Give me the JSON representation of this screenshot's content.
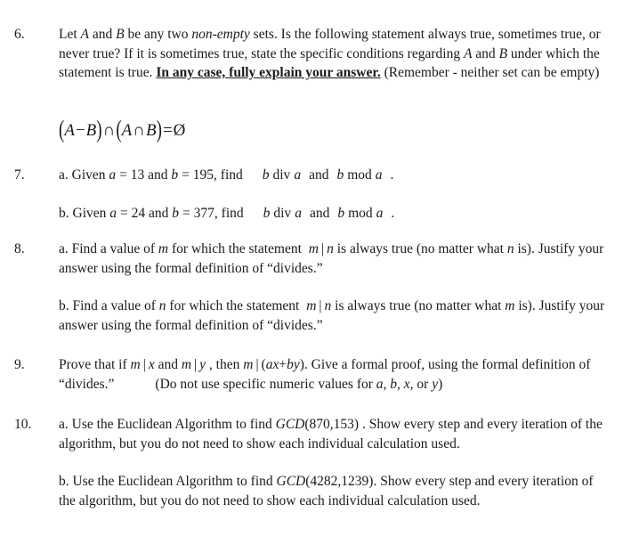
{
  "document": {
    "type": "homework-problem-set",
    "background_color": "#ffffff",
    "text_color": "#1a1a1a"
  },
  "problems": [
    {
      "number": "6.",
      "parts": [
        {
          "id": "p6",
          "segments": [
            {
              "text": "Let ",
              "style": "normal"
            },
            {
              "text": "A",
              "style": "italic"
            },
            {
              "text": " and ",
              "style": "normal"
            },
            {
              "text": "B",
              "style": "italic"
            },
            {
              "text": " be any two ",
              "style": "normal"
            },
            {
              "text": "non-empty",
              "style": "italic"
            },
            {
              "text": " sets.  Is the following statement always true, sometimes true, or never true?  If it is sometimes true, state the specific conditions regarding ",
              "style": "normal"
            },
            {
              "text": "A",
              "style": "italic"
            },
            {
              "text": " and ",
              "style": "normal"
            },
            {
              "text": "B",
              "style": "italic"
            },
            {
              "text": " under which the statement is true.  ",
              "style": "normal"
            },
            {
              "text": "In any case, fully explain your answer.",
              "style": "bold-underline"
            },
            {
              "text": "  (Remember - neither set can be empty)",
              "style": "normal"
            }
          ]
        }
      ],
      "display_math": "(A-B)∩(A∩B)=∅",
      "display_math_tokens": {
        "open_paren": "(",
        "a": "A",
        "minus": "−",
        "b": "B",
        "close_paren": ")",
        "cap1": "∩",
        "open_paren2": "(",
        "a2": "A",
        "cap2": "∩",
        "b2": "B",
        "close_paren2": ")",
        "equals": "=",
        "emptyset": "Ø"
      }
    },
    {
      "number": "7.",
      "parts": [
        {
          "id": "p7a",
          "label": "a.",
          "segments": [
            {
              "text": "a.  Given ",
              "style": "normal"
            },
            {
              "text": "a",
              "style": "italic"
            },
            {
              "text": " = 13",
              "style": "normal"
            },
            {
              "text": " and ",
              "style": "normal"
            },
            {
              "text": "b",
              "style": "italic"
            },
            {
              "text": " = 195",
              "style": "normal"
            },
            {
              "text": ", find ",
              "style": "normal"
            },
            {
              "text": "b",
              "style": "italic"
            },
            {
              "text": "div",
              "style": "normal"
            },
            {
              "text": "a",
              "style": "italic"
            },
            {
              "text": " and ",
              "style": "normal"
            },
            {
              "text": "b",
              "style": "italic"
            },
            {
              "text": "mod",
              "style": "normal"
            },
            {
              "text": "a",
              "style": "italic"
            },
            {
              "text": " .",
              "style": "normal"
            }
          ],
          "values": {
            "a": "13",
            "b": "195"
          }
        },
        {
          "id": "p7b",
          "label": "b.",
          "segments": [
            {
              "text": "b.  Given ",
              "style": "normal"
            },
            {
              "text": "a",
              "style": "italic"
            },
            {
              "text": " = 24",
              "style": "normal"
            },
            {
              "text": " and ",
              "style": "normal"
            },
            {
              "text": "b",
              "style": "italic"
            },
            {
              "text": " = 377",
              "style": "normal"
            },
            {
              "text": ", find ",
              "style": "normal"
            },
            {
              "text": "b",
              "style": "italic"
            },
            {
              "text": "div",
              "style": "normal"
            },
            {
              "text": "a",
              "style": "italic"
            },
            {
              "text": " and ",
              "style": "normal"
            },
            {
              "text": "b",
              "style": "italic"
            },
            {
              "text": "mod",
              "style": "normal"
            },
            {
              "text": "a",
              "style": "italic"
            },
            {
              "text": " .",
              "style": "normal"
            }
          ],
          "values": {
            "a": "24",
            "b": "377"
          }
        }
      ]
    },
    {
      "number": "8.",
      "parts": [
        {
          "id": "p8a",
          "label": "a.",
          "text_plain": "a.  Find a value of m for which the statement m|n is always true (no matter what n is). Justify your answer using the formal definition of “divides.”"
        },
        {
          "id": "p8b",
          "label": "b.",
          "text_plain": "b.  Find a value of n for which the statement m|n is always true (no matter what m is). Justify your answer using the formal definition of “divides.”"
        }
      ]
    },
    {
      "number": "9.",
      "parts": [
        {
          "id": "p9",
          "text_plain": "Prove that if m|x and m|y , then m|(ax+by). Give a formal proof, using the formal definition of “divides.”        (Do not use specific numeric values for a, b, x, or y)"
        }
      ]
    },
    {
      "number": "10.",
      "parts": [
        {
          "id": "p10a",
          "label": "a.",
          "text_plain": "a.  Use the Euclidean Algorithm to find GCD(870,153) .  Show every step and every iteration of the algorithm, but you do not need to show each individual calculation used.",
          "gcd_args": "870,153"
        },
        {
          "id": "p10b",
          "label": "b.",
          "text_plain": "b.  Use the Euclidean Algorithm to find GCD(4282,1239).  Show every step and every iteration of the algorithm, but you do not need to show each individual calculation used.",
          "gcd_args": "4282,1239"
        }
      ]
    }
  ],
  "text": {
    "q6": {
      "lead": "Let ",
      "setA": "A",
      "and1": " and ",
      "setB": "B",
      "mid1": " be any two ",
      "nonempty": "non-empty",
      "mid2": " sets.  Is the following statement always true, sometimes true, or never true?  If it is sometimes true, state the specific conditions regarding ",
      "setA2": "A",
      "and2": " and ",
      "setB2": "B",
      "mid3": " under which the statement is true.  ",
      "emphasis": "In any case, fully explain your answer.",
      "tail": "  (Remember - neither set can be empty)"
    },
    "q7a": {
      "lead": "a.  Given ",
      "var_a": "a",
      "eq_a": "= 13",
      "and": " and ",
      "var_b": "b",
      "eq_b": "= 195",
      "find": ", find",
      "b1": "b",
      "div": "div",
      "a1": "a",
      "and2": "and",
      "b2": "b",
      "mod": "mod",
      "a2": "a",
      "period": "."
    },
    "q7b": {
      "lead": "b.  Given ",
      "var_a": "a",
      "eq_a": "= 24",
      "and": " and ",
      "var_b": "b",
      "eq_b": "= 377",
      "find": ", find",
      "b1": "b",
      "div": "div",
      "a1": "a",
      "and2": "and",
      "b2": "b",
      "mod": "mod",
      "a2": "a",
      "period": "."
    },
    "q8a": {
      "lead": "a.  Find a value of ",
      "var_m": "m",
      "mid1": " for which the statement ",
      "m": "m",
      "bar": "|",
      "n": "n",
      "mid2": " is always true (no matter what ",
      "var_n": "n",
      "mid3": " is). Justify your answer using the formal definition of “divides.”"
    },
    "q8b": {
      "lead": "b.  Find a value of ",
      "var_n": "n",
      "mid1": " for which the statement ",
      "m": "m",
      "bar": "|",
      "n": "n",
      "mid2": " is always true (no matter what ",
      "var_m": "m",
      "mid3": " is). Justify your answer using the formal definition of “divides.”"
    },
    "q9": {
      "lead": "Prove that if ",
      "m1": "m",
      "bar1": "|",
      "x1": "x",
      "and": " and ",
      "m2": "m",
      "bar2": "|",
      "y1": "y",
      "then": " , then ",
      "m3": "m",
      "bar3": "|",
      "expr_open": "(",
      "ax": "ax",
      "plus": "+",
      "by": "by",
      "expr_close": ")",
      "mid": ". Give a formal proof, using the formal definition of “divides.”",
      "paren_note": "(Do not use specific numeric values for ",
      "vars": "a, b, x,",
      "or": " or ",
      "y_var": "y",
      "note_close": ")"
    },
    "q10a": {
      "lead": "a.  Use the Euclidean Algorithm to find ",
      "gcd": "GCD",
      "args": "(870,153)",
      "tail": " .  Show every step and every iteration of the algorithm, but you do not need to show each individual calculation used."
    },
    "q10b": {
      "lead": "b.  Use the Euclidean Algorithm to find ",
      "gcd": "GCD",
      "args": "(4282,1239)",
      "tail": ".  Show every step and every iteration of the algorithm, but you do not need to show each individual calculation used."
    }
  }
}
